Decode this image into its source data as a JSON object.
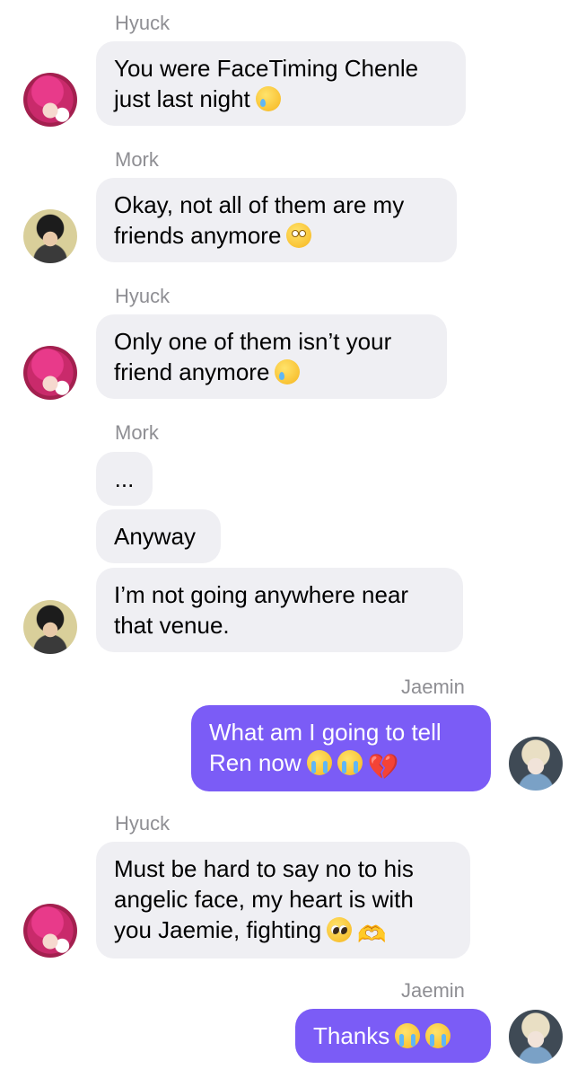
{
  "chat": {
    "messages": [
      {
        "sender": "Hyuck",
        "text": "You were FaceTiming Chenle",
        "text2": "just last night"
      },
      {
        "sender": "Mork",
        "text": "Okay, not all of them are my",
        "text2": "friends anymore"
      },
      {
        "sender": "Hyuck",
        "text": "Only one of them isn’t your",
        "text2": "friend anymore"
      },
      {
        "sender": "Mork",
        "text": "...",
        "text_b": "Anyway",
        "text_c": "I’m not going anywhere near",
        "text_c2": "that venue."
      },
      {
        "sender": "Jaemin",
        "text": "What am I going to tell",
        "text2": "Ren now"
      },
      {
        "sender": "Hyuck",
        "text": "Must be hard to say no to his",
        "text2": "angelic face, my heart is with",
        "text3": "you Jaemie, fighting"
      },
      {
        "sender": "Jaemin",
        "text": "Thanks"
      }
    ]
  },
  "icons": {
    "heart": "💔",
    "hands": "🫶"
  },
  "colors": {
    "incoming_bubble": "#efeff3",
    "outgoing_bubble": "#7b5cf6",
    "sender_name": "#8e8e93"
  }
}
